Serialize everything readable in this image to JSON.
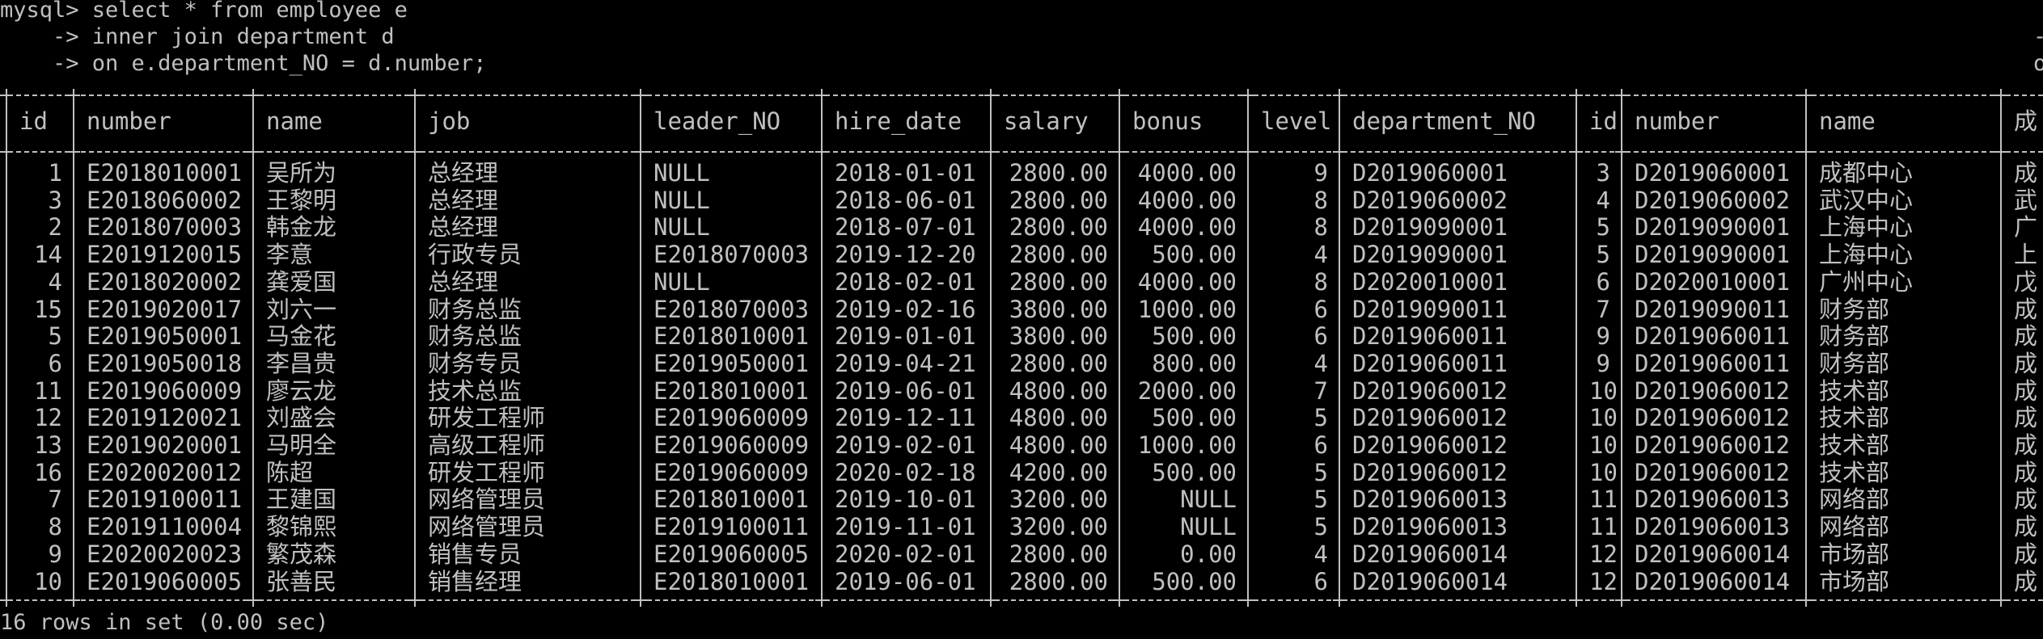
{
  "terminal": {
    "prompt_lines": [
      "mysql> select * from employee e",
      "    -> inner join department d",
      "    -> on e.department_NO = d.number;"
    ],
    "right_edge_fragments": [
      "-",
      "o"
    ],
    "columns": [
      "id",
      "number",
      "name",
      "job",
      "leader_NO",
      "hire_date",
      "salary",
      "bonus",
      "level",
      "department_NO",
      "id",
      "number",
      "name",
      "成"
    ],
    "rows": [
      [
        "1",
        "E2018010001",
        "吴所为",
        "总经理",
        "NULL",
        "2018-01-01",
        "2800.00",
        "4000.00",
        "9",
        "D2019060001",
        "3",
        "D2019060001",
        "成都中心",
        "成"
      ],
      [
        "3",
        "E2018060002",
        "王黎明",
        "总经理",
        "NULL",
        "2018-06-01",
        "2800.00",
        "4000.00",
        "8",
        "D2019060002",
        "4",
        "D2019060002",
        "武汉中心",
        "武"
      ],
      [
        "2",
        "E2018070003",
        "韩金龙",
        "总经理",
        "NULL",
        "2018-07-01",
        "2800.00",
        "4000.00",
        "8",
        "D2019090001",
        "5",
        "D2019090001",
        "上海中心",
        "广"
      ],
      [
        "14",
        "E2019120015",
        "李意",
        "行政专员",
        "E2018070003",
        "2019-12-20",
        "2800.00",
        "500.00",
        "4",
        "D2019090001",
        "5",
        "D2019090001",
        "上海中心",
        "上"
      ],
      [
        "4",
        "E2018020002",
        "龚爱国",
        "总经理",
        "NULL",
        "2018-02-01",
        "2800.00",
        "4000.00",
        "8",
        "D2020010001",
        "6",
        "D2020010001",
        "广州中心",
        "戊"
      ],
      [
        "15",
        "E2019020017",
        "刘六一",
        "财务总监",
        "E2018070003",
        "2019-02-16",
        "3800.00",
        "1000.00",
        "6",
        "D2019090011",
        "7",
        "D2019090011",
        "财务部",
        "成"
      ],
      [
        "5",
        "E2019050001",
        "马金花",
        "财务总监",
        "E2018010001",
        "2019-01-01",
        "3800.00",
        "500.00",
        "6",
        "D2019060011",
        "9",
        "D2019060011",
        "财务部",
        "成"
      ],
      [
        "6",
        "E2019050018",
        "李昌贵",
        "财务专员",
        "E2019050001",
        "2019-04-21",
        "2800.00",
        "800.00",
        "4",
        "D2019060011",
        "9",
        "D2019060011",
        "财务部",
        "成"
      ],
      [
        "11",
        "E2019060009",
        "廖云龙",
        "技术总监",
        "E2018010001",
        "2019-06-01",
        "4800.00",
        "2000.00",
        "7",
        "D2019060012",
        "10",
        "D2019060012",
        "技术部",
        "成"
      ],
      [
        "12",
        "E2019120021",
        "刘盛会",
        "研发工程师",
        "E2019060009",
        "2019-12-11",
        "4800.00",
        "500.00",
        "5",
        "D2019060012",
        "10",
        "D2019060012",
        "技术部",
        "成"
      ],
      [
        "13",
        "E2019020001",
        "马明全",
        "高级工程师",
        "E2019060009",
        "2019-02-01",
        "4800.00",
        "1000.00",
        "6",
        "D2019060012",
        "10",
        "D2019060012",
        "技术部",
        "成"
      ],
      [
        "16",
        "E2020020012",
        "陈超",
        "研发工程师",
        "E2019060009",
        "2020-02-18",
        "4200.00",
        "500.00",
        "5",
        "D2019060012",
        "10",
        "D2019060012",
        "技术部",
        "成"
      ],
      [
        "7",
        "E2019100011",
        "王建国",
        "网络管理员",
        "E2018010001",
        "2019-10-01",
        "3200.00",
        "NULL",
        "5",
        "D2019060013",
        "11",
        "D2019060013",
        "网络部",
        "成"
      ],
      [
        "8",
        "E2019110004",
        "黎锦熙",
        "网络管理员",
        "E2019100011",
        "2019-11-01",
        "3200.00",
        "NULL",
        "5",
        "D2019060013",
        "11",
        "D2019060013",
        "网络部",
        "成"
      ],
      [
        "9",
        "E2020020023",
        "繁茂森",
        "销售专员",
        "E2019060005",
        "2020-02-01",
        "2800.00",
        "0.00",
        "4",
        "D2019060014",
        "12",
        "D2019060014",
        "市场部",
        "成"
      ],
      [
        "10",
        "E2019060005",
        "张善民",
        "销售经理",
        "E2018010001",
        "2019-06-01",
        "2800.00",
        "500.00",
        "6",
        "D2019060014",
        "12",
        "D2019060014",
        "市场部",
        "成"
      ]
    ],
    "footer": "16 rows in set (0.00 sec)"
  }
}
